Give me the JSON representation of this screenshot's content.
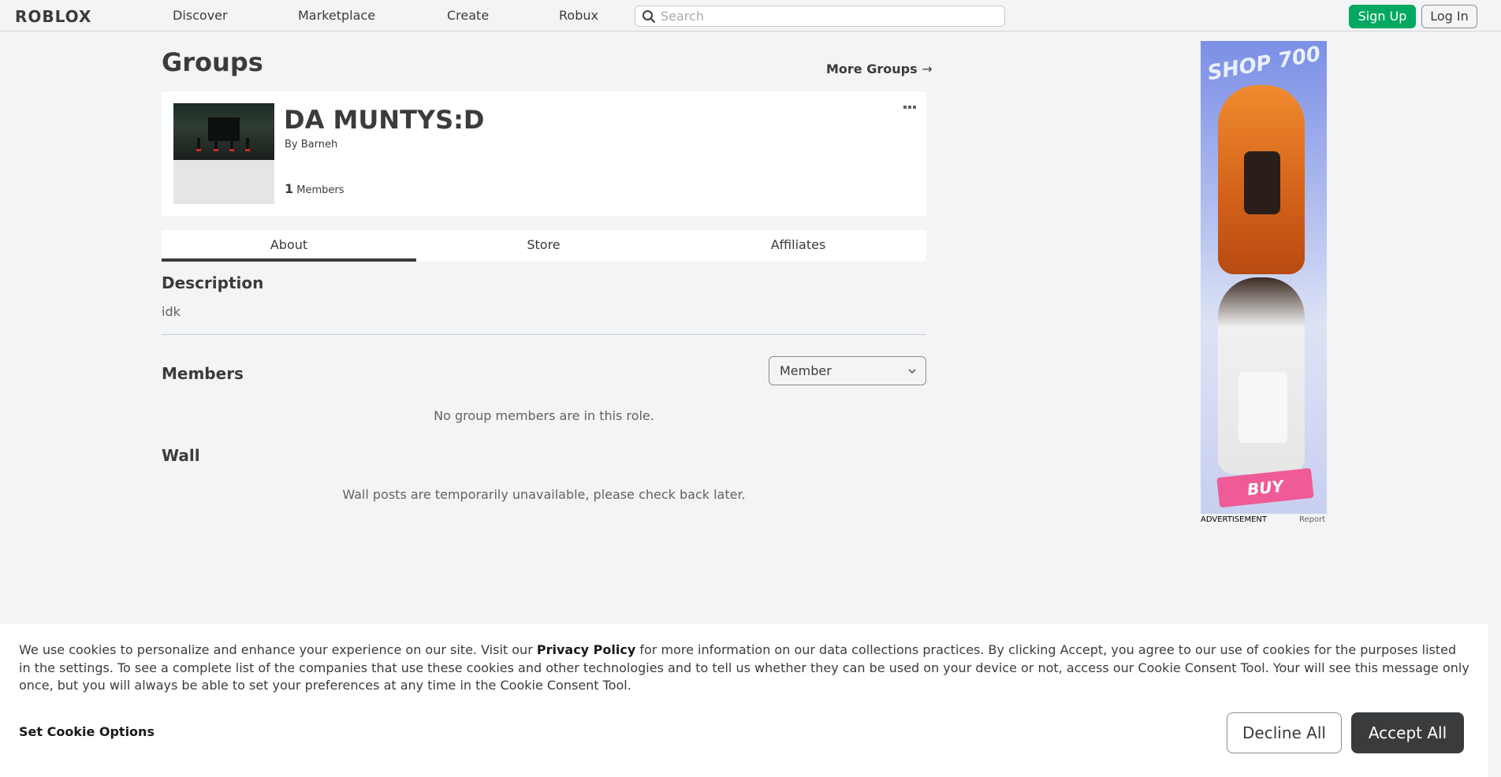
{
  "nav": {
    "logo": "ROBLOX",
    "links": [
      "Discover",
      "Marketplace",
      "Create",
      "Robux"
    ],
    "search_placeholder": "Search",
    "signup": "Sign Up",
    "login": "Log In"
  },
  "page": {
    "title": "Groups",
    "more_groups": "More Groups"
  },
  "group": {
    "name": "DA MUNTYS:D",
    "by_label": "By",
    "owner": "Barneh",
    "member_count": "1",
    "members_label": "Members"
  },
  "tabs": [
    "About",
    "Store",
    "Affiliates"
  ],
  "about": {
    "description_title": "Description",
    "description_text": "idk",
    "members_title": "Members",
    "role_selected": "Member",
    "no_members": "No group members are in this role.",
    "wall_title": "Wall",
    "wall_note": "Wall posts are temporarily unavailable, please check back later."
  },
  "ad": {
    "shop_text": "SHOP 700",
    "buy_text": "BUY",
    "label": "ADVERTISEMENT",
    "report": "Report"
  },
  "cookie": {
    "text_before": "We use cookies to personalize and enhance your experience on our site. Visit our",
    "privacy_policy": "Privacy Policy",
    "text_after": "for more information on our data collections practices. By clicking Accept, you agree to our use of cookies for the purposes listed in the settings. To see a complete list of the companies that use these cookies and other technologies and to tell us whether they can be used on your device or not, access our Cookie Consent Tool. Your will see this message only once, but you will always be able to set your preferences at any time in the Cookie Consent Tool.",
    "set_options": "Set Cookie Options",
    "decline": "Decline All",
    "accept": "Accept All"
  },
  "colors": {
    "signup_green": "#00a862",
    "accept_dark": "#393b3d",
    "page_bg": "#f2f4f5"
  }
}
